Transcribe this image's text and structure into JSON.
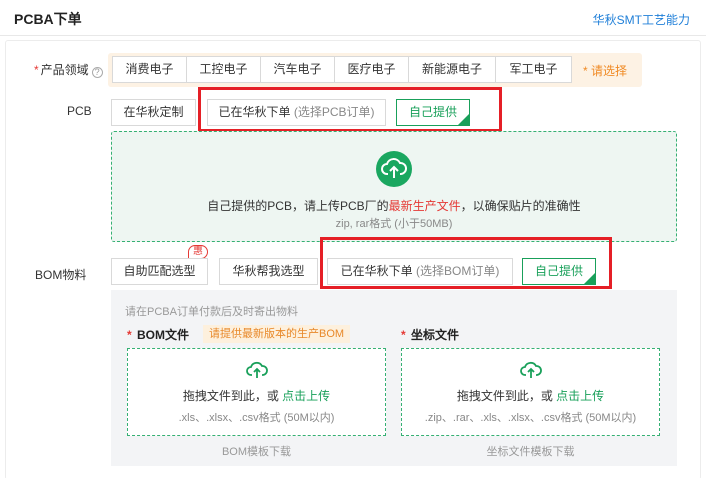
{
  "header": {
    "title": "PCBA下单",
    "link": "华秋SMT工艺能力"
  },
  "industry": {
    "required": "*",
    "label": "产品领域",
    "help_icon": "?",
    "options": [
      "消费电子",
      "工控电子",
      "汽车电子",
      "医疗电子",
      "新能源电子",
      "军工电子"
    ],
    "hint": "* 请选择"
  },
  "pcb": {
    "label": "PCB",
    "options": {
      "custom": "在华秋定制",
      "ordered_main": "已在华秋下单",
      "ordered_sub": "(选择PCB订单)",
      "self": "自己提供"
    },
    "selected": "self",
    "upload": {
      "main_prefix": "自己提供的PCB，请上传PCB厂的",
      "main_highlight": "最新生产文件",
      "main_suffix": "，以确保贴片的准确性",
      "sub": "zip, rar格式 (小于50MB)"
    }
  },
  "bom": {
    "label": "BOM物料",
    "badge": "惠",
    "options": {
      "auto": "自助匹配选型",
      "hq": "华秋帮我选型",
      "ordered_main": "已在华秋下单",
      "ordered_sub": "(选择BOM订单)",
      "self": "自己提供"
    },
    "selected": "self",
    "note": "请在PCBA订单付款后及时寄出物料",
    "bom_file": {
      "required": "*",
      "title": "BOM文件",
      "warning": "请提供最新版本的生产BOM",
      "drop_prefix": "拖拽文件到此，或 ",
      "drop_link": "点击上传",
      "formats": ".xls、.xlsx、.csv格式 (50M以内)",
      "template": "BOM模板下载"
    },
    "coord_file": {
      "required": "*",
      "title": "坐标文件",
      "drop_prefix": "拖拽文件到此，或 ",
      "drop_link": "点击上传",
      "formats": ".zip、.rar、.xls、.xlsx、.csv格式 (50M以内)",
      "template": "坐标文件模板下载"
    }
  },
  "colors": {
    "accent": "#19a05a",
    "annotation": "#e51f26",
    "warning": "#f08a24",
    "link": "#1f7fd8"
  },
  "icons": [
    "help-icon",
    "cloud-upload-icon",
    "check-icon",
    "red-arrow-annotation"
  ]
}
